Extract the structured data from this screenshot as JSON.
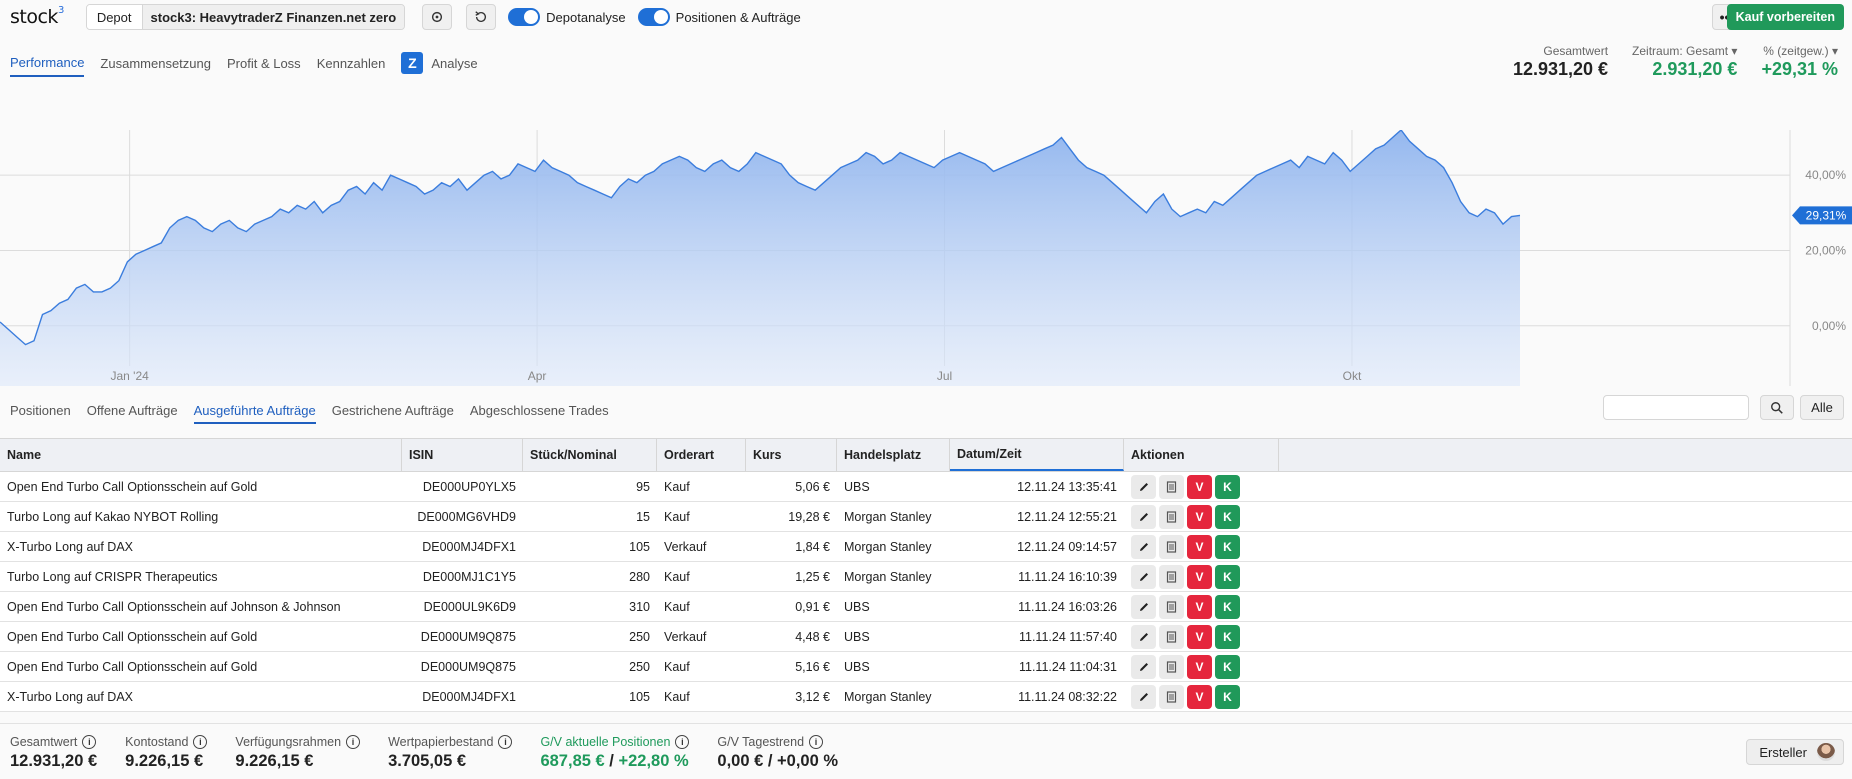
{
  "header": {
    "logo": "stock",
    "logo_sup": "3",
    "depot_label": "Depot",
    "depot_value": "stock3: HeavytraderZ Finanzen.net zero",
    "refresh_icon": "refresh-icon",
    "reset_icon": "undo-icon",
    "toggle_depotanalyse": "Depotanalyse",
    "toggle_positionen": "Positionen & Aufträge",
    "more_label": "•••",
    "buy_label": "Kauf vorbereiten"
  },
  "nav": {
    "tabs": [
      "Performance",
      "Zusammensetzung",
      "Profit & Loss",
      "Kennzahlen"
    ],
    "analyse_label": "Analyse",
    "analyse_icon": "Z"
  },
  "stats": {
    "gesamtwert_label": "Gesamtwert",
    "gesamtwert_value": "12.931,20 €",
    "zeitraum_label": "Zeitraum: Gesamt ▾",
    "zeitraum_value": "2.931,20 €",
    "pct_label": "% (zeitgew.) ▾",
    "pct_value": "+29,31 %"
  },
  "chart_data": {
    "type": "area",
    "x_tick_labels": [
      "Jan '24",
      "Apr",
      "Jul",
      "Okt"
    ],
    "y_tick_labels": [
      "40,00%",
      "20,00%",
      "0,00%"
    ],
    "current_label": "29,31%",
    "ylim": [
      -16,
      52
    ],
    "grid": true,
    "fill_color": "#a9c6f3",
    "line_color": "#3b7ddd",
    "values": [
      1,
      -1,
      -3,
      -5,
      -4,
      3,
      4,
      6,
      7,
      10,
      11,
      9,
      9,
      10,
      12,
      17,
      19,
      20,
      21,
      22,
      26,
      28,
      29,
      28,
      26,
      25,
      27,
      28,
      26,
      25,
      27,
      28,
      29,
      31,
      30,
      32,
      31,
      33,
      30,
      32,
      33,
      36,
      37,
      35,
      38,
      36,
      40,
      39,
      38,
      37,
      35,
      36,
      38,
      37,
      39,
      36,
      38,
      40,
      41,
      39,
      40,
      43,
      42,
      41,
      44,
      42,
      41,
      40,
      38,
      37,
      36,
      35,
      34,
      37,
      39,
      38,
      40,
      41,
      43,
      44,
      45,
      44,
      42,
      41,
      43,
      44,
      42,
      41,
      43,
      46,
      45,
      44,
      43,
      40,
      38,
      37,
      36,
      38,
      40,
      42,
      43,
      44,
      46,
      45,
      43,
      44,
      46,
      45,
      44,
      43,
      42,
      44,
      45,
      46,
      45,
      44,
      43,
      41,
      42,
      43,
      44,
      45,
      46,
      47,
      48,
      50,
      47,
      44,
      42,
      41,
      40,
      38,
      36,
      34,
      32,
      30,
      33,
      35,
      31,
      29,
      30,
      31,
      30,
      33,
      32,
      34,
      36,
      38,
      40,
      41,
      42,
      43,
      44,
      42,
      45,
      44,
      43,
      46,
      44,
      41,
      43,
      45,
      47,
      48,
      50,
      52,
      49,
      47,
      45,
      44,
      42,
      38,
      33,
      30,
      29,
      31,
      30,
      27,
      29,
      29.31
    ]
  },
  "subtabs": [
    "Positionen",
    "Offene Aufträge",
    "Ausgeführte Aufträge",
    "Gestrichene Aufträge",
    "Abgeschlossene Trades"
  ],
  "search": {
    "placeholder": "",
    "icon": "search-icon",
    "alle_label": "Alle"
  },
  "table": {
    "headers": [
      "Name",
      "ISIN",
      "Stück/Nominal",
      "Orderart",
      "Kurs",
      "Handelsplatz",
      "Datum/Zeit",
      "Aktionen"
    ],
    "action_labels": {
      "sell": "V",
      "buy": "K"
    },
    "rows": [
      [
        "Open End Turbo Call Optionsschein auf Gold",
        "DE000UP0YLX5",
        "95",
        "Kauf",
        "5,06 €",
        "UBS",
        "12.11.24 13:35:41"
      ],
      [
        "Turbo Long auf Kakao NYBOT Rolling",
        "DE000MG6VHD9",
        "15",
        "Kauf",
        "19,28 €",
        "Morgan Stanley",
        "12.11.24 12:55:21"
      ],
      [
        "X-Turbo Long auf DAX",
        "DE000MJ4DFX1",
        "105",
        "Verkauf",
        "1,84 €",
        "Morgan Stanley",
        "12.11.24 09:14:57"
      ],
      [
        "Turbo Long auf CRISPR Therapeutics",
        "DE000MJ1C1Y5",
        "280",
        "Kauf",
        "1,25 €",
        "Morgan Stanley",
        "11.11.24 16:10:39"
      ],
      [
        "Open End Turbo Call Optionsschein auf Johnson & Johnson",
        "DE000UL9K6D9",
        "310",
        "Kauf",
        "0,91 €",
        "UBS",
        "11.11.24 16:03:26"
      ],
      [
        "Open End Turbo Call Optionsschein auf Gold",
        "DE000UM9Q875",
        "250",
        "Verkauf",
        "4,48 €",
        "UBS",
        "11.11.24 11:57:40"
      ],
      [
        "Open End Turbo Call Optionsschein auf Gold",
        "DE000UM9Q875",
        "250",
        "Kauf",
        "5,16 €",
        "UBS",
        "11.11.24 11:04:31"
      ],
      [
        "X-Turbo Long auf DAX",
        "DE000MJ4DFX1",
        "105",
        "Kauf",
        "3,12 €",
        "Morgan Stanley",
        "11.11.24 08:32:22"
      ]
    ]
  },
  "footer": {
    "gesamtwert_label": "Gesamtwert",
    "gesamtwert_value": "12.931,20 €",
    "kontostand_label": "Kontostand",
    "kontostand_value": "9.226,15 €",
    "verfuegung_label": "Verfügungsrahmen",
    "verfuegung_value": "9.226,15 €",
    "wertpapier_label": "Wertpapierbestand",
    "wertpapier_value": "3.705,05 €",
    "gv_akt_label": "G/V aktuelle Positionen",
    "gv_akt_value_a": "687,85 €",
    "gv_akt_sep": " / ",
    "gv_akt_value_b": "+22,80 %",
    "gv_tag_label": "G/V Tagestrend",
    "gv_tag_value": "0,00 € / +0,00 %",
    "info_icon": "i",
    "creator_label": "Ersteller"
  }
}
